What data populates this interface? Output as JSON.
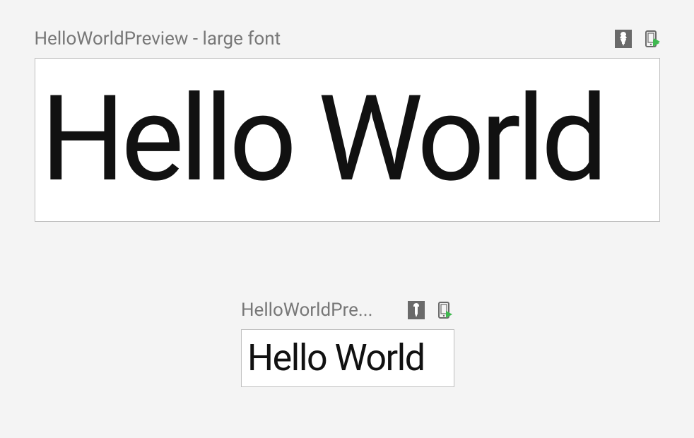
{
  "previews": [
    {
      "title": "HelloWorldPreview - large font",
      "content": "Hello World",
      "size": "large"
    },
    {
      "title": "HelloWorldPre...",
      "content": "Hello World",
      "size": "small"
    }
  ]
}
